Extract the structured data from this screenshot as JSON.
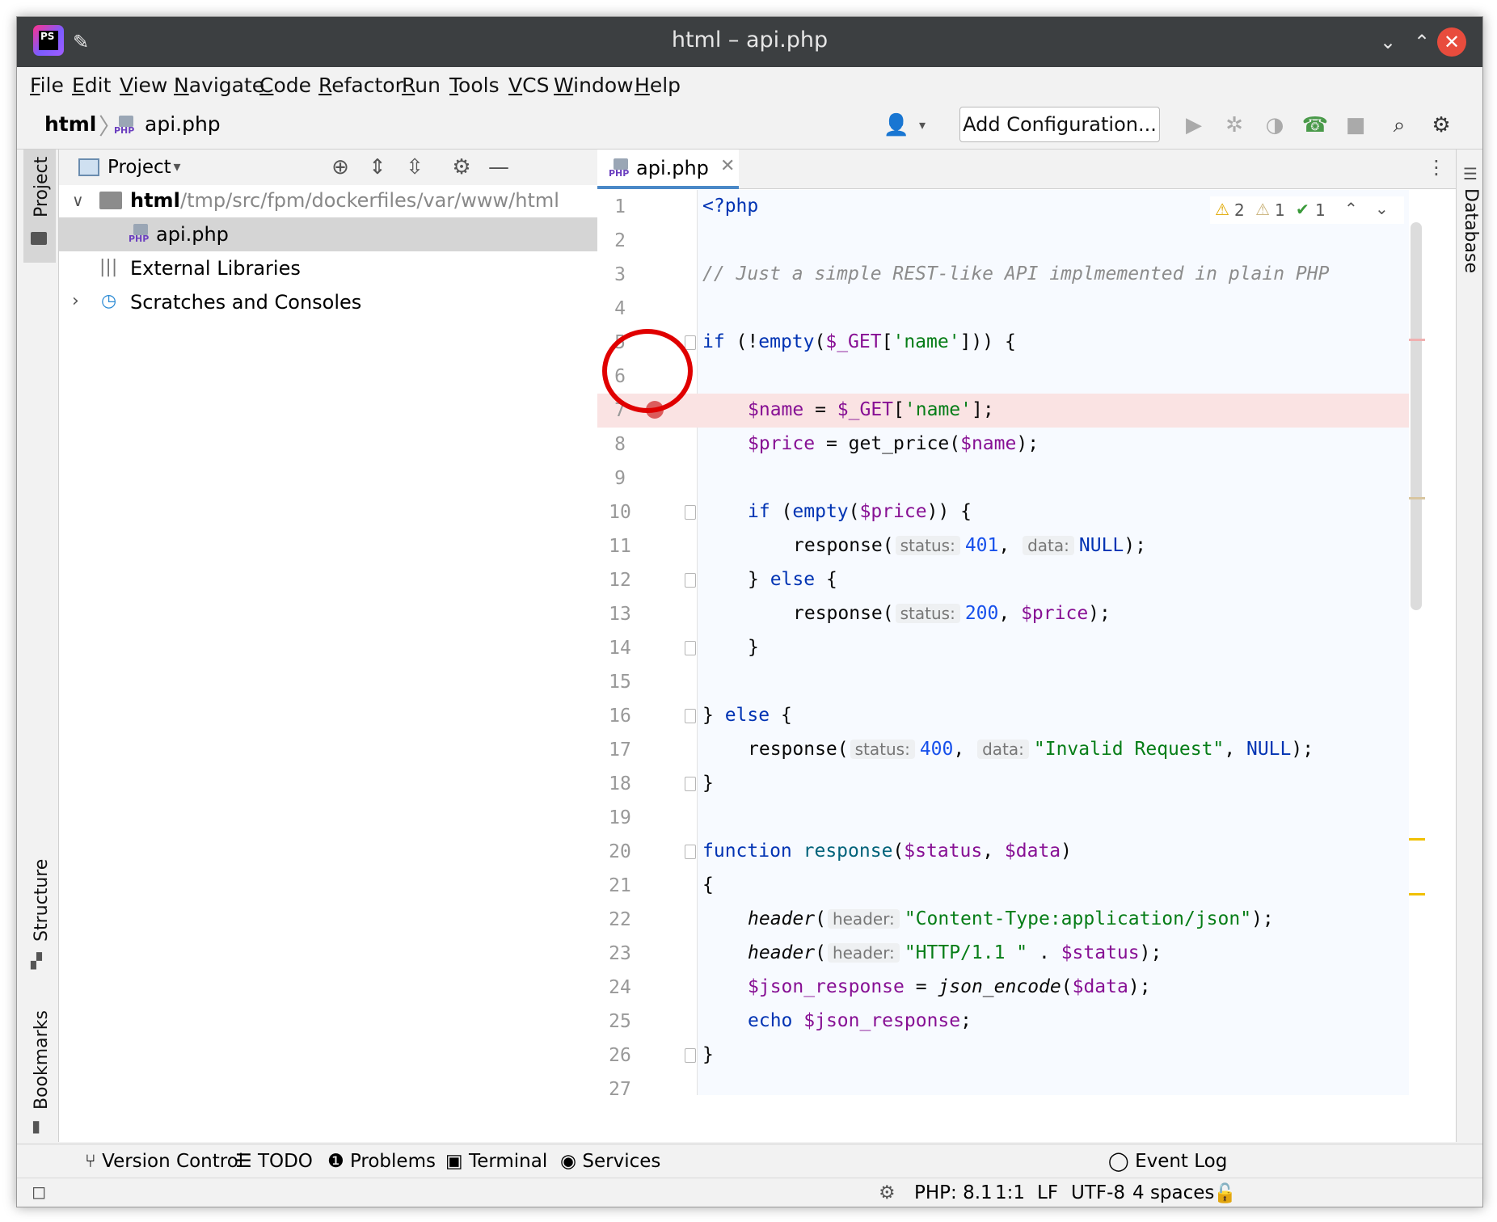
{
  "window": {
    "title": "html – api.php"
  },
  "menu": [
    "File",
    "Edit",
    "View",
    "Navigate",
    "Code",
    "Refactor",
    "Run",
    "Tools",
    "VCS",
    "Window",
    "Help"
  ],
  "breadcrumb": {
    "project": "html",
    "file": "api.php"
  },
  "toolbar": {
    "add_configuration": "Add Configuration..."
  },
  "left_tabs": {
    "project": "Project",
    "structure": "Structure",
    "bookmarks": "Bookmarks"
  },
  "right_tabs": {
    "database": "Database"
  },
  "project_panel": {
    "title": "Project",
    "tree": [
      {
        "label": "html",
        "path": "/tmp/src/fpm/dockerfiles/var/www/html"
      },
      {
        "label": "api.php"
      },
      {
        "label": "External Libraries"
      },
      {
        "label": "Scratches and Consoles"
      }
    ]
  },
  "editor": {
    "tab": "api.php",
    "php_badge": "PHP",
    "inspections": {
      "warnings": "2",
      "weak_warnings": "1",
      "ok": "1"
    },
    "hints": {
      "status": "status:",
      "data": "data:",
      "header": "header:"
    },
    "lines": [
      {
        "n": "1"
      },
      {
        "n": "2"
      },
      {
        "n": "3"
      },
      {
        "n": "4"
      },
      {
        "n": "5"
      },
      {
        "n": "6"
      },
      {
        "n": "7"
      },
      {
        "n": "8"
      },
      {
        "n": "9"
      },
      {
        "n": "10"
      },
      {
        "n": "11"
      },
      {
        "n": "12"
      },
      {
        "n": "13"
      },
      {
        "n": "14"
      },
      {
        "n": "15"
      },
      {
        "n": "16"
      },
      {
        "n": "17"
      },
      {
        "n": "18"
      },
      {
        "n": "19"
      },
      {
        "n": "20"
      },
      {
        "n": "21"
      },
      {
        "n": "22"
      },
      {
        "n": "23"
      },
      {
        "n": "24"
      },
      {
        "n": "25"
      },
      {
        "n": "26"
      },
      {
        "n": "27"
      }
    ],
    "code": {
      "l1": "<?php",
      "l3": "// Just a simple REST-like API implmemented in plain PHP",
      "l5_if": "if",
      "l5_rest1": " (!",
      "l5_fn": "empty",
      "l5_rest2": "(",
      "l5_var": "$_GET",
      "l5_rest3": "[",
      "l5_str": "'name'",
      "l5_rest4": "])) {",
      "l7_var1": "$name",
      "l7_rest1": " = ",
      "l7_var2": "$_GET",
      "l7_rest2": "[",
      "l7_str": "'name'",
      "l7_rest3": "];",
      "l8_var1": "$price",
      "l8_rest1": " = get_price(",
      "l8_var2": "$name",
      "l8_rest2": ");",
      "l10_if": "if",
      "l10_rest1": " (",
      "l10_fn": "empty",
      "l10_rest2": "(",
      "l10_var": "$price",
      "l10_rest3": ")) {",
      "l11_call": "response(",
      "l11_num": "401",
      "l11_sep": ", ",
      "l11_null": "NULL",
      "l11_end": ");",
      "l12_a": "} ",
      "l12_else": "else",
      "l12_b": " {",
      "l13_call": "response(",
      "l13_num": "200",
      "l13_sep": ", ",
      "l13_var": "$price",
      "l13_end": ");",
      "l14": "}",
      "l16_a": "} ",
      "l16_else": "else",
      "l16_b": " {",
      "l17_call": "response(",
      "l17_num": "400",
      "l17_sep": ", ",
      "l17_str": "\"Invalid Request\"",
      "l17_sep2": ", ",
      "l17_null": "NULL",
      "l17_end": ");",
      "l18": "}",
      "l20_kw": "function",
      "l20_sp": " ",
      "l20_fn": "response",
      "l20_a": "(",
      "l20_v1": "$status",
      "l20_b": ", ",
      "l20_v2": "$data",
      "l20_c": ")",
      "l21": "{",
      "l22_fn": "header",
      "l22_a": "(",
      "l22_str": "\"Content-Type:application/json\"",
      "l22_end": ");",
      "l23_fn": "header",
      "l23_a": "(",
      "l23_str": "\"HTTP/1.1 \"",
      "l23_b": " . ",
      "l23_var": "$status",
      "l23_end": ");",
      "l24_var": "$json_response",
      "l24_a": " = ",
      "l24_fn": "json_encode",
      "l24_b": "(",
      "l24_var2": "$data",
      "l24_end": ");",
      "l25_kw": "echo",
      "l25_sp": " ",
      "l25_var": "$json_response",
      "l25_end": ";",
      "l26": "}"
    }
  },
  "tool_windows": [
    "Version Control",
    "TODO",
    "Problems",
    "Terminal",
    "Services"
  ],
  "event_log": "Event Log",
  "status_bar": {
    "php": "PHP: 8.1",
    "position": "1:1",
    "line_sep": "LF",
    "encoding": "UTF-8",
    "indent": "4 spaces"
  },
  "colors": {
    "breakpoint": "#db5c5c",
    "highlight_circle": "#e00000",
    "accent": "#4a88c7"
  }
}
